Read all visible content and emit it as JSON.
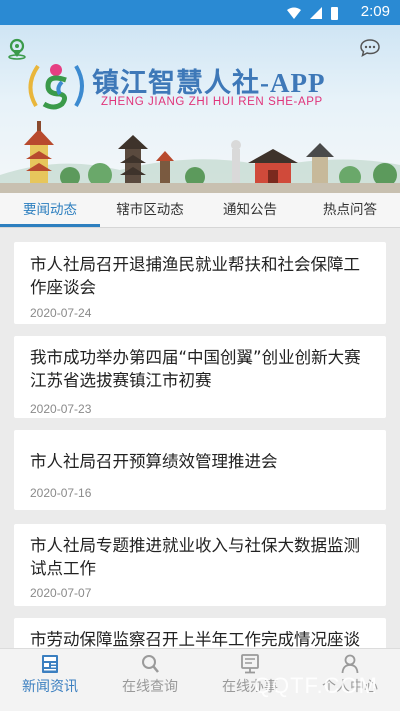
{
  "status_bar": {
    "time": "2:09",
    "icons": [
      "wifi-icon",
      "signal-icon",
      "battery-icon"
    ]
  },
  "header": {
    "app_title": "镇江智慧人社-APP",
    "app_subtitle": "ZHENG JIANG ZHI HUI REN SHE-APP"
  },
  "tabs": [
    {
      "label": "要闻动态",
      "active": true
    },
    {
      "label": "辖市区动态",
      "active": false
    },
    {
      "label": "通知公告",
      "active": false
    },
    {
      "label": "热点问答",
      "active": false
    }
  ],
  "news": [
    {
      "title": "市人社局召开退捕渔民就业帮扶和社会保障工作座谈会",
      "date": "2020-07-24"
    },
    {
      "title": "我市成功举办第四届“中国创翼”创业创新大赛江苏省选拔赛镇江市初赛",
      "date": "2020-07-23"
    },
    {
      "title": "市人社局召开预算绩效管理推进会",
      "date": "2020-07-16"
    },
    {
      "title": "市人社局专题推进就业收入与社保大数据监测试点工作",
      "date": "2020-07-07"
    },
    {
      "title": "市劳动保障监察召开上半年工作完成情况座谈",
      "date": ""
    }
  ],
  "bottom_nav": [
    {
      "label": "新闻资讯",
      "icon": "news-icon",
      "active": true
    },
    {
      "label": "在线查询",
      "icon": "search-icon",
      "active": false
    },
    {
      "label": "在线办事",
      "icon": "service-icon",
      "active": false
    },
    {
      "label": "个人中心",
      "icon": "user-icon",
      "active": false
    }
  ],
  "watermark": "QQTF.COM",
  "colors": {
    "status_bar": "#2a8ad3",
    "accent": "#2d7fbf",
    "title_blue": "#3e78b8",
    "subtitle_pink": "#e0337a"
  }
}
